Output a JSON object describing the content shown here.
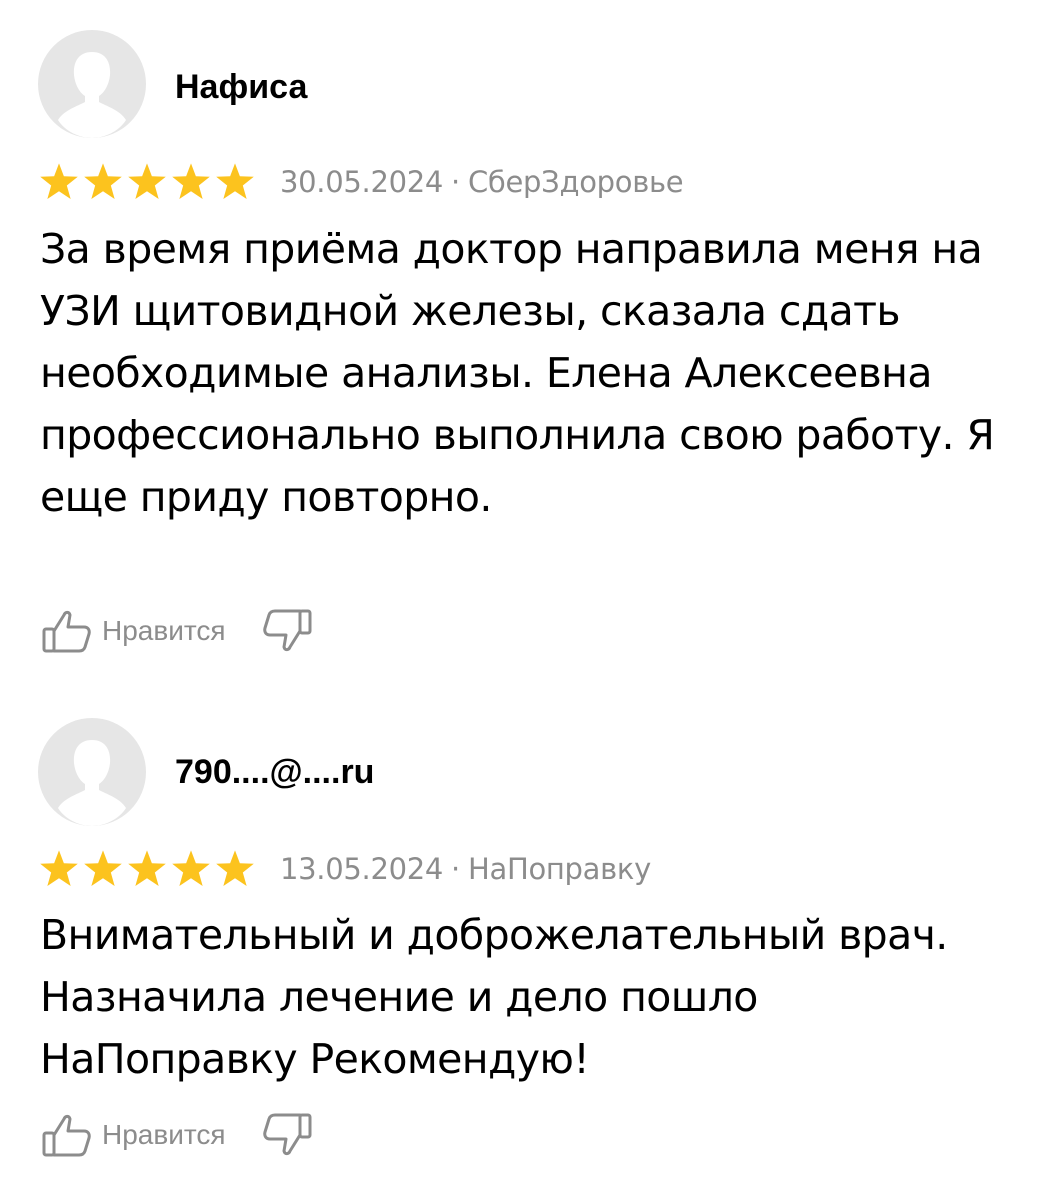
{
  "reviews": [
    {
      "author": "Нафиса",
      "avatar_icon": "user-silhouette-icon",
      "rating": 5,
      "rating_max": 5,
      "date": "30.05.2024",
      "separator": "·",
      "source": "СберЗдоровье",
      "text": "За время приёма доктор направила меня на УЗИ щитовидной железы, сказала сдать необходимые анализы. Елена Алексеевна профессионально выполнила свою работу. Я еще приду повторно.",
      "like_label": "Нравится",
      "like_icon": "thumbs-up-icon",
      "dislike_icon": "thumbs-down-icon"
    },
    {
      "author": "790....@....ru",
      "avatar_icon": "user-silhouette-icon",
      "rating": 5,
      "rating_max": 5,
      "date": "13.05.2024",
      "separator": "·",
      "source": "НаПоправку",
      "text": "Внимательный и доброжелательный врач. Назначила лечение и дело пошло НаПоправку Рекомендую!",
      "like_label": "Нравится",
      "like_icon": "thumbs-up-icon",
      "dislike_icon": "thumbs-down-icon"
    }
  ],
  "colors": {
    "star": "#FCC31E",
    "meta_text": "#8C8C8C",
    "avatar_bg": "#E6E6E6",
    "avatar_silhouette": "#FFFFFF",
    "icon_stroke": "#8C8C8C"
  }
}
